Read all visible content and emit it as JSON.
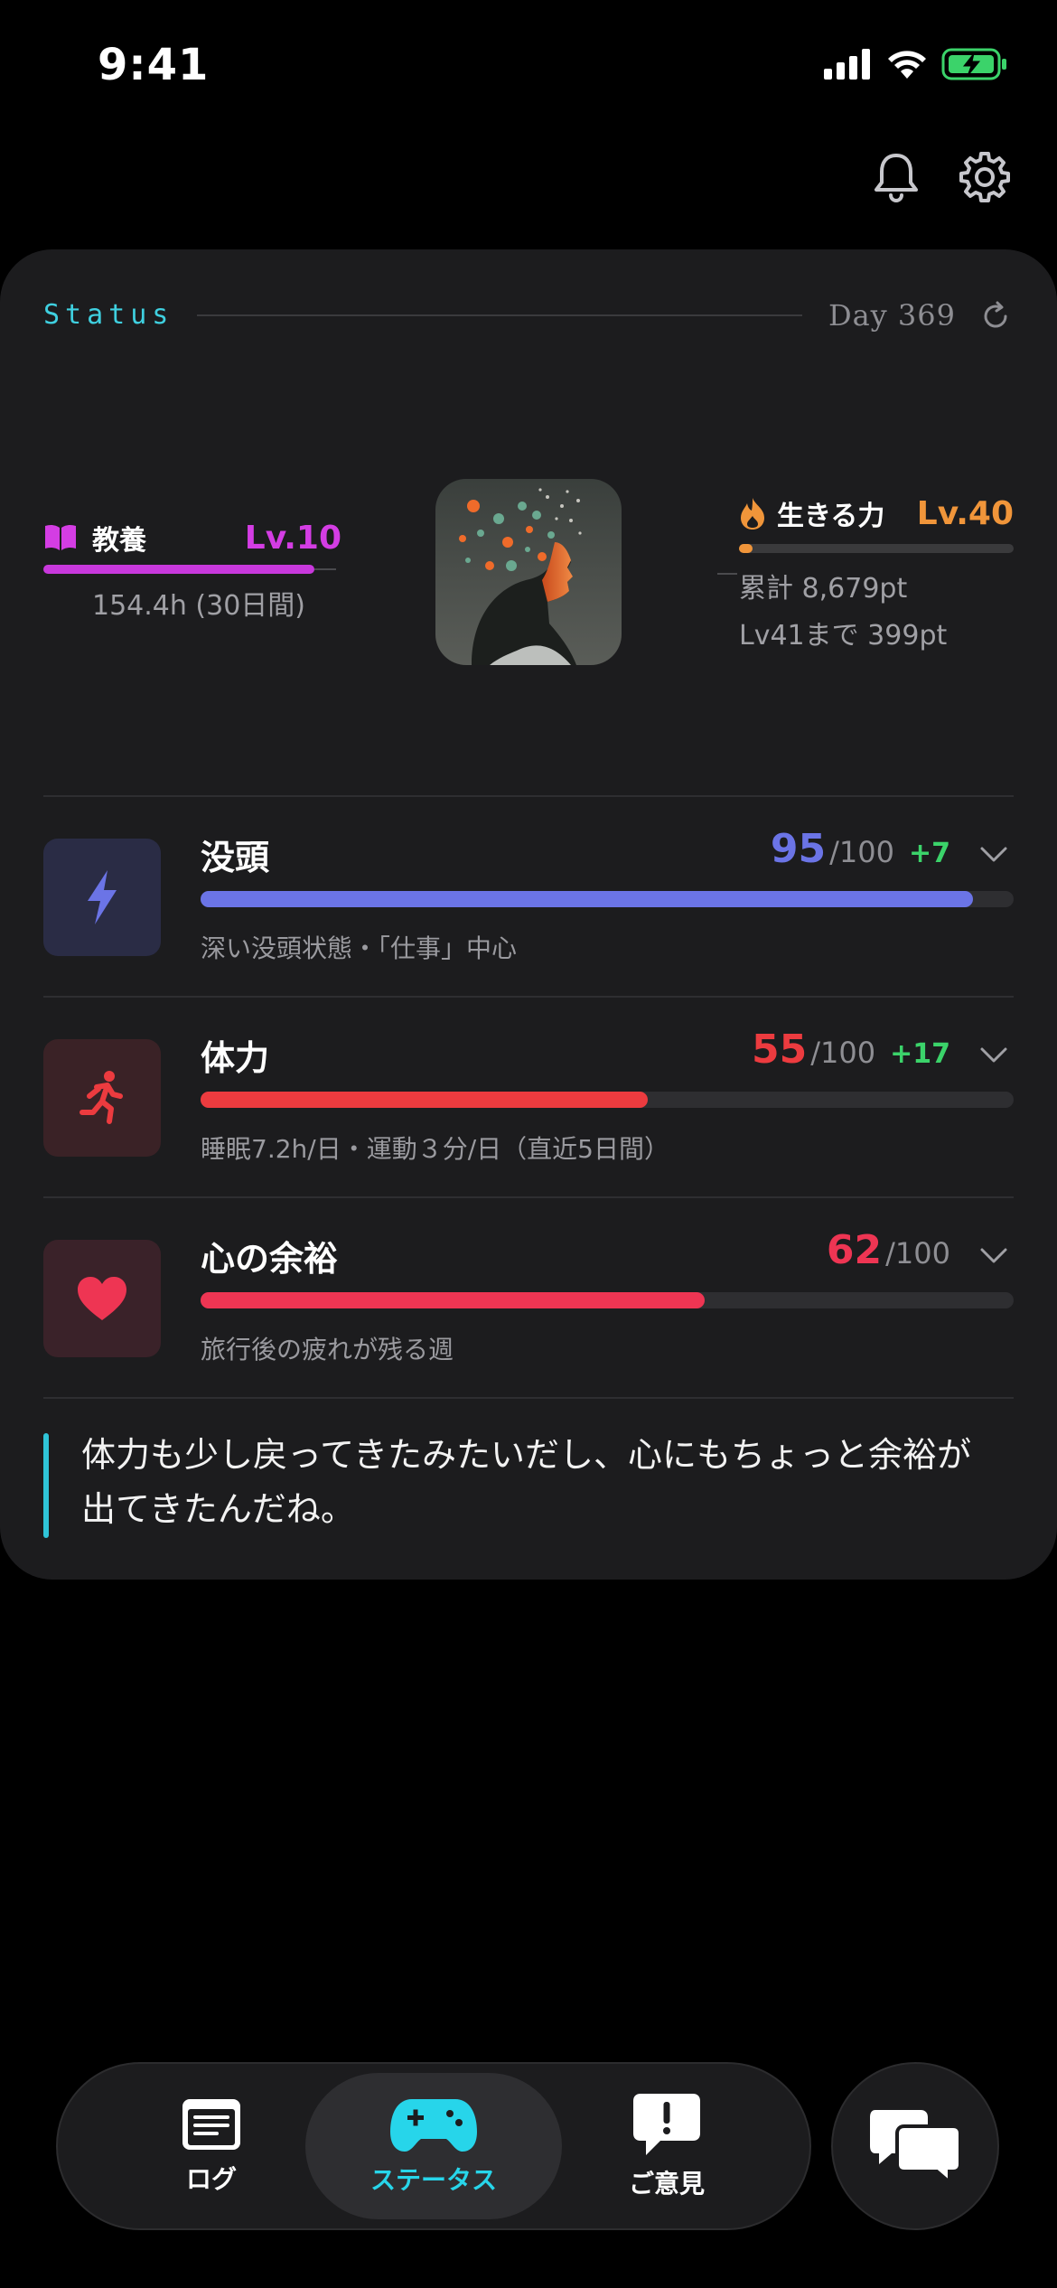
{
  "status_bar": {
    "time": "9:41"
  },
  "card": {
    "title": "Status",
    "day": "Day 369",
    "left_level": {
      "name": "教養",
      "level": "Lv.10",
      "sub": "154.4h (30日間)"
    },
    "right_level": {
      "name": "生きる力",
      "level": "Lv.40",
      "progress": 0.05,
      "total": "累計 8,679pt",
      "next": "Lv41まで 399pt"
    },
    "stats": [
      {
        "name": "没頭",
        "score": "95",
        "max": "/100",
        "delta": "+7",
        "value": 95,
        "note": "深い没頭状態・「仕事」中心",
        "color": "#6b74e6",
        "icon": "lightning-icon"
      },
      {
        "name": "体力",
        "score": "55",
        "max": "/100",
        "delta": "+17",
        "value": 55,
        "note": "睡眠7.2h/日・運動３分/日（直近5日間）",
        "color": "#ec3b3f",
        "icon": "running-icon"
      },
      {
        "name": "心の余裕",
        "score": "62",
        "max": "/100",
        "delta": "",
        "value": 62,
        "note": "旅行後の疲れが残る週",
        "color": "#ee3553",
        "icon": "heart-icon"
      }
    ],
    "quote": "体力も少し戻ってきたみたいだし、心にもちょっと余裕が出てきたんだね。"
  },
  "tabs": [
    {
      "label": "ログ",
      "icon": "log-icon"
    },
    {
      "label": "ステータス",
      "icon": "gamepad-icon"
    },
    {
      "label": "ご意見",
      "icon": "feedback-icon"
    }
  ]
}
